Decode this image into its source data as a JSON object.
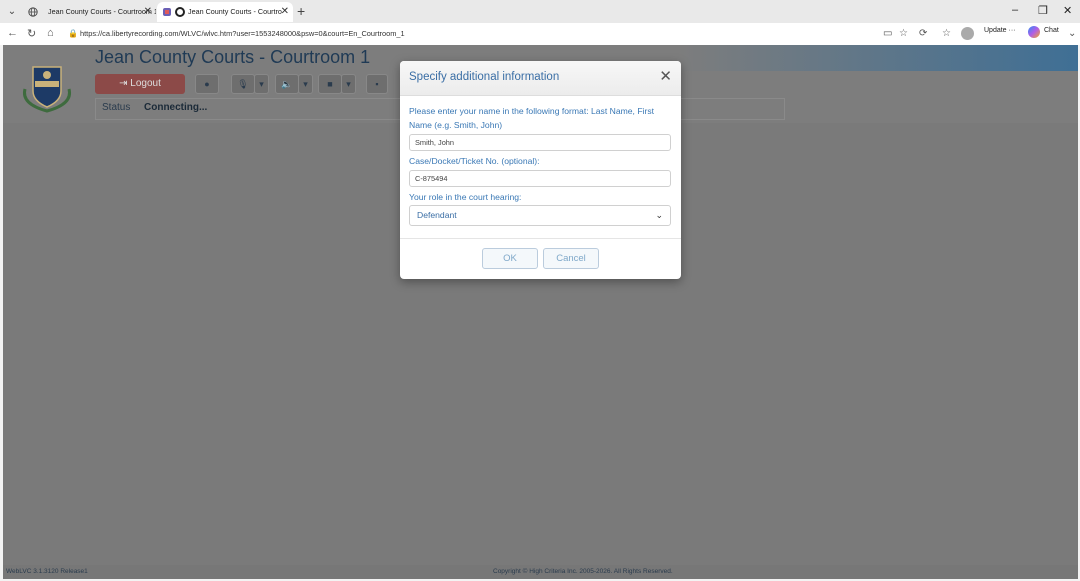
{
  "browser": {
    "tabs": [
      {
        "title": "Jean County Courts - Courtroom 1"
      },
      {
        "title": "Jean County Courts - Courtro"
      }
    ],
    "url": "https://ca.libertyrecording.com/WLVC/wlvc.htm?user=1553248000&psw=0&court=En_Courtroom_1",
    "update_label": "Update",
    "chat_label": "Chat"
  },
  "page": {
    "court_title": "Jean County Courts - Courtroom 1",
    "logout_label": "Logout",
    "status_label": "Status",
    "status_value": "Connecting...",
    "footer_version": "WebLVC 3.1.3120 Release1",
    "footer_copyright": "Copyright © High Criteria Inc. 2005-2026. All Rights Reserved."
  },
  "modal": {
    "title": "Specify additional information",
    "name_label": "Please enter your name in the following format: Last Name, First Name (e.g. Smith, John)",
    "name_value": "Smith, John",
    "case_label": "Case/Docket/Ticket No. (optional):",
    "case_value": "C-875494",
    "role_label": "Your role in the court hearing:",
    "role_value": "Defendant",
    "ok_label": "OK",
    "cancel_label": "Cancel"
  }
}
